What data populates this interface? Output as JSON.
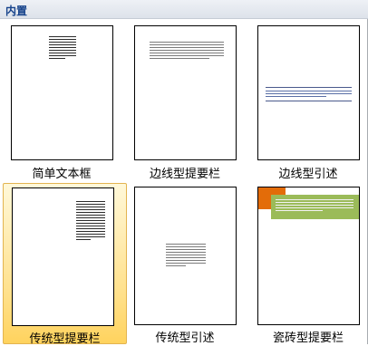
{
  "gallery": {
    "header": "内置",
    "items": [
      {
        "label": "简单文本框"
      },
      {
        "label": "边线型提要栏"
      },
      {
        "label": "边线型引述"
      },
      {
        "label": "传统型提要栏",
        "selected": true
      },
      {
        "label": "传统型引述"
      },
      {
        "label": "瓷砖型提要栏"
      }
    ]
  },
  "colors": {
    "header_text": "#15428b",
    "selected_fill": "#ffe08a",
    "tile_orange": "#e36c09",
    "tile_green": "#9bbb59"
  }
}
